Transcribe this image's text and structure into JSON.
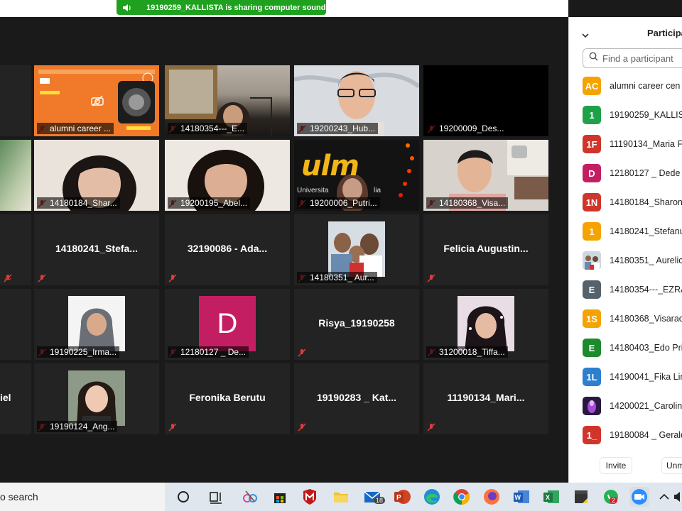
{
  "banner": {
    "text": "19190259_KALLISTA is sharing computer sound"
  },
  "tiles": [
    {
      "label": "alumni career ...",
      "center": ""
    },
    {
      "label": "14180354---_E...",
      "center": ""
    },
    {
      "label": "19200243_Hub...",
      "center": ""
    },
    {
      "label": "19200009_Des...",
      "center": ""
    },
    {
      "label": "14180184_Shar...",
      "center": ""
    },
    {
      "label": "19200195_Abel...",
      "center": ""
    },
    {
      "label": "19200006_Putri...",
      "center": ""
    },
    {
      "label": "14180368_Visa...",
      "center": ""
    },
    {
      "label": "",
      "center": "14180241_Stefa..."
    },
    {
      "label": "",
      "center": "32190086 - Ada..."
    },
    {
      "label": "14180351_ Aur...",
      "center": ""
    },
    {
      "label": "",
      "center": "Felicia  Augustin..."
    },
    {
      "label": "19190225_Irma...",
      "center": ""
    },
    {
      "label": "12180127 _ De...",
      "center": "",
      "avatar_letter": "D"
    },
    {
      "label": "",
      "center": "Risya_19190258"
    },
    {
      "label": "31200018_Tiffa...",
      "center": ""
    },
    {
      "label": "19190124_Ang...",
      "center": ""
    },
    {
      "label": "",
      "center": "Feronika Berutu"
    },
    {
      "label": "",
      "center": "19190283 _ Kat..."
    },
    {
      "label": "",
      "center": "11190134_Mari..."
    },
    {
      "label": "",
      "center": "iel"
    }
  ],
  "logo": {
    "text": "ulm",
    "sub": "Universita",
    "sub2": "lia"
  },
  "panel": {
    "title": "Participa",
    "search_placeholder": "Find a participant",
    "invite": "Invite",
    "unmute": "Unm"
  },
  "participants": [
    {
      "badge": "AC",
      "name": "alumni career cen",
      "color": "#f5a300"
    },
    {
      "badge": "1",
      "name": "19190259_KALLIST",
      "color": "#1fa14a"
    },
    {
      "badge": "1F",
      "name": "11190134_Maria F",
      "color": "#d0352c"
    },
    {
      "badge": "D",
      "name": "12180127 _ Dede",
      "color": "#c41e63"
    },
    {
      "badge": "1N",
      "name": "14180184_Sharon",
      "color": "#d0352c"
    },
    {
      "badge": "1",
      "name": "14180241_Stefanu",
      "color": "#f5a300"
    },
    {
      "badge": "",
      "name": "14180351_ Aurelic",
      "color": "#6a8aa8"
    },
    {
      "badge": "E",
      "name": "14180354---_EZRA",
      "color": "#56626b"
    },
    {
      "badge": "1S",
      "name": "14180368_Visarac",
      "color": "#f5a300"
    },
    {
      "badge": "E",
      "name": "14180403_Edo Pri",
      "color": "#1d8a2c"
    },
    {
      "badge": "1L",
      "name": "14190041_Fika Lim",
      "color": "#2d7fd0"
    },
    {
      "badge": "",
      "name": "14200021_Carolin",
      "color": "#7a2fb0"
    },
    {
      "badge": "1_",
      "name": "19180084 _ Gerald",
      "color": "#d0352c"
    }
  ],
  "taskbar": {
    "search_text": "o search",
    "mail_badge": "18",
    "whatsapp_badge": "2"
  },
  "colors": {
    "active_border": "#c6e34b",
    "banner_green": "#1fa11f",
    "mute_red": "#e03b3b"
  }
}
